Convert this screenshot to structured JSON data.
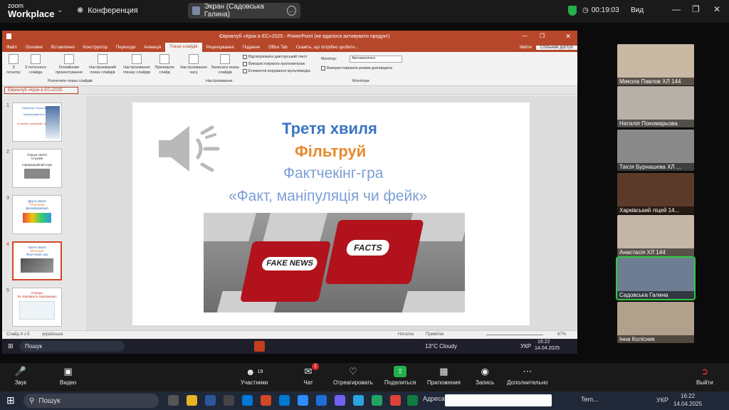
{
  "zoom": {
    "logo_top": "zoom",
    "logo_bottom": "Workplace",
    "meeting_title": "Конференция",
    "screen_share_label": "Экран (Садовська Галина)",
    "timer": "00:19:03",
    "view_label": "Вид",
    "accent": "#2ecc40"
  },
  "ppt": {
    "window_title": "Євроклуб «Крок в ЄС»2025 - PowerPoint (не вдалося активувати продукт)",
    "menu": [
      "Файл",
      "Основне",
      "Вставлення",
      "Конструктор",
      "Переходи",
      "Анімація",
      "Показ слайдів",
      "Рецензування",
      "Подання",
      "Office Tab"
    ],
    "active_menu": "Показ слайдів",
    "menu_right": [
      "Скажіть, що потрібно зробити...",
      "Увійти",
      "Спільний доступ"
    ],
    "ribbon": {
      "buttons": [
        "З початку",
        "З поточного слайда",
        "Онлайнове презентування",
        "Настроюваний показ слайдів",
        "Настроювання показу слайдів",
        "Приховати слайд",
        "Настроювання часу",
        "Записати показ слайдів"
      ],
      "checks": [
        "Відтворювати дикторський текст",
        "Використовувати хронометраж",
        "Елементи керування мультимедіа"
      ],
      "group_start": "Розпочати показ слайдів",
      "group_setup": "Настроювання",
      "group_monitors": "Монітори",
      "monitor_label": "Монітор:",
      "monitor_value": "Автоматично",
      "presenter_view": "Використовувати режим доповідача"
    },
    "file_tab": "Євроклуб «Крок в ЄС»2025",
    "thumbs": [
      {
        "num": "1",
        "lines": [
          "Євроклуб «Крок в ЄС»",
          "Інформаційна гігієна",
          "«Слухай, розпізнай, фільтруй»"
        ]
      },
      {
        "num": "2",
        "lines": [
          "Перша хвиля",
          "Слухай!",
          "Інформаційний шум"
        ]
      },
      {
        "num": "3",
        "lines": [
          "Друга хвиля",
          "Розпізнай",
          "Дезінформація"
        ]
      },
      {
        "num": "4",
        "lines": [
          "Третя хвиля",
          "Фільтруй",
          "Фактчекінг-гра"
        ]
      },
      {
        "num": "5",
        "lines": [
          "Поради",
          "Як перевірити інформацію"
        ]
      }
    ],
    "slide": {
      "title": "Третя хвиля",
      "subtitle": "Фільтруй",
      "line3": "Фактчекінг-гра",
      "line4": "«Факт, маніпуляція чи фейк»",
      "key_left": "FAKE NEWS",
      "key_right": "FACTS"
    },
    "status": {
      "slide_info": "Слайд 4 з 5",
      "lang": "українська",
      "notes": "Нотатки",
      "comments": "Примітки",
      "zoom": "67%"
    },
    "remote_taskbar": {
      "search": "Пошук",
      "weather": "13°C Cloudy",
      "lang": "УКР",
      "time": "16:22",
      "date": "14.04.2025"
    }
  },
  "participants": [
    {
      "name": "Микола Павлов ХЛ 144",
      "bg": "#c9b8a3"
    },
    {
      "name": "Наталія Пономарьова",
      "bg": "#b7b0a6"
    },
    {
      "name": "Таісія Бурнашева ХЛ ...",
      "bg": "#8a8a8a"
    },
    {
      "name": "Харківський ліцей 14...",
      "bg": "#5c3a2a"
    },
    {
      "name": "Анастасія ХЛ 144",
      "bg": "#c4b7a7"
    },
    {
      "name": "Садовська Галина",
      "bg": "#6f7d93"
    },
    {
      "name": "Інна Колісник",
      "bg": "#b0a08c"
    }
  ],
  "controls": {
    "audio": "Звук",
    "video": "Видео",
    "participants": "Участники",
    "participants_count": "19",
    "chat": "Чат",
    "chat_badge": "1",
    "react": "Отреагировать",
    "share": "Поделиться",
    "apps": "Приложения",
    "record": "Запись",
    "more": "Дополнительно",
    "leave": "Выйти"
  },
  "taskbar": {
    "search": "Пошук",
    "address_label": "Адреса",
    "weather": "Tem...",
    "lang": "УКР",
    "time": "16:22",
    "date": "14.04.2025"
  }
}
